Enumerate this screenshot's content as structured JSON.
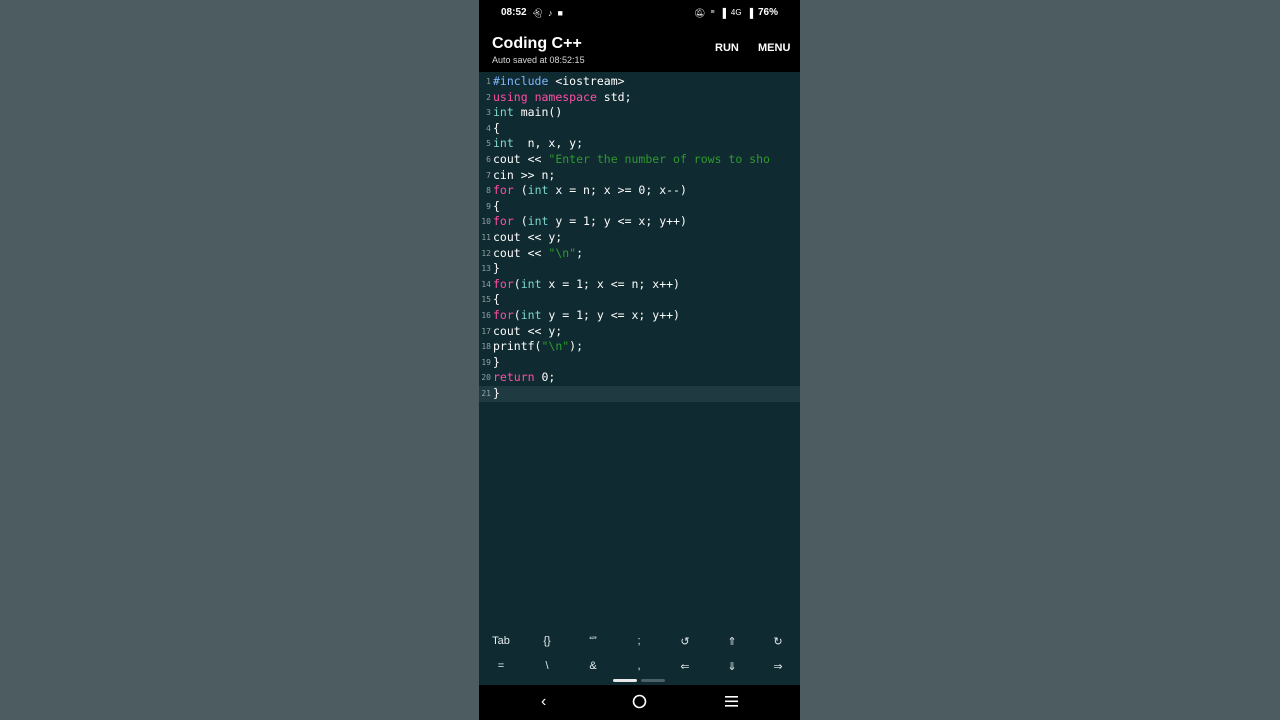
{
  "status": {
    "time": "08:52",
    "left_icons": [
      "snapchat-icon",
      "tiktok-icon",
      "video-icon"
    ],
    "right_icons": [
      "silent-icon",
      "volte-icon",
      "signal-icon",
      "4g-icon",
      "signal-icon"
    ],
    "network": "4G",
    "battery": "76%"
  },
  "app": {
    "title": "Coding C++",
    "autosave": "Auto saved at 08:52:15",
    "run_label": "RUN",
    "menu_label": "MENU"
  },
  "editor": {
    "lines": [
      {
        "n": "1",
        "segments": [
          {
            "t": "#include",
            "c": "kw-blue"
          },
          {
            "t": " <iostream>",
            "c": ""
          }
        ]
      },
      {
        "n": "2",
        "segments": [
          {
            "t": "using",
            "c": "kw-pink"
          },
          {
            "t": " ",
            "c": ""
          },
          {
            "t": "namespace",
            "c": "kw-pink"
          },
          {
            "t": " std;",
            "c": ""
          }
        ]
      },
      {
        "n": "3",
        "segments": [
          {
            "t": "int",
            "c": "kw-teal"
          },
          {
            "t": " main()",
            "c": ""
          }
        ]
      },
      {
        "n": "4",
        "segments": [
          {
            "t": "{",
            "c": ""
          }
        ]
      },
      {
        "n": "5",
        "segments": [
          {
            "t": "int",
            "c": "kw-teal"
          },
          {
            "t": "  n, x, y;",
            "c": ""
          }
        ]
      },
      {
        "n": "6",
        "segments": [
          {
            "t": "cout << ",
            "c": ""
          },
          {
            "t": "\"Enter the number of rows to sho",
            "c": "str"
          }
        ]
      },
      {
        "n": "7",
        "segments": [
          {
            "t": "cin >> n;",
            "c": ""
          }
        ]
      },
      {
        "n": "8",
        "segments": [
          {
            "t": "for",
            "c": "kw-pink"
          },
          {
            "t": " (",
            "c": ""
          },
          {
            "t": "int",
            "c": "kw-teal"
          },
          {
            "t": " x = n; x >= 0; x--)",
            "c": ""
          }
        ]
      },
      {
        "n": "9",
        "segments": [
          {
            "t": "{",
            "c": ""
          }
        ]
      },
      {
        "n": "10",
        "segments": [
          {
            "t": "for",
            "c": "kw-pink"
          },
          {
            "t": " (",
            "c": ""
          },
          {
            "t": "int",
            "c": "kw-teal"
          },
          {
            "t": " y = 1; y <= x; y++)",
            "c": ""
          }
        ]
      },
      {
        "n": "11",
        "segments": [
          {
            "t": "cout << y;",
            "c": ""
          }
        ]
      },
      {
        "n": "12",
        "segments": [
          {
            "t": "cout << ",
            "c": ""
          },
          {
            "t": "\"\\n\"",
            "c": "str"
          },
          {
            "t": ";",
            "c": ""
          }
        ]
      },
      {
        "n": "13",
        "segments": [
          {
            "t": "}",
            "c": ""
          }
        ]
      },
      {
        "n": "14",
        "segments": [
          {
            "t": "for",
            "c": "kw-pink"
          },
          {
            "t": "(",
            "c": ""
          },
          {
            "t": "int",
            "c": "kw-teal"
          },
          {
            "t": " x = 1; x <= n; x++)",
            "c": ""
          }
        ]
      },
      {
        "n": "15",
        "segments": [
          {
            "t": "{",
            "c": ""
          }
        ]
      },
      {
        "n": "16",
        "segments": [
          {
            "t": "for",
            "c": "kw-pink"
          },
          {
            "t": "(",
            "c": ""
          },
          {
            "t": "int",
            "c": "kw-teal"
          },
          {
            "t": " y = 1; y <= x; y++)",
            "c": ""
          }
        ]
      },
      {
        "n": "17",
        "segments": [
          {
            "t": "cout << y;",
            "c": ""
          }
        ]
      },
      {
        "n": "18",
        "segments": [
          {
            "t": "printf(",
            "c": ""
          },
          {
            "t": "\"\\n\"",
            "c": "str"
          },
          {
            "t": ");",
            "c": ""
          }
        ]
      },
      {
        "n": "19",
        "segments": [
          {
            "t": "}",
            "c": ""
          }
        ]
      },
      {
        "n": "20",
        "segments": [
          {
            "t": "return",
            "c": "kw-pink"
          },
          {
            "t": " 0;",
            "c": ""
          }
        ]
      },
      {
        "n": "21",
        "segments": [
          {
            "t": "}",
            "c": ""
          }
        ],
        "current": true
      }
    ]
  },
  "keys": {
    "row1": [
      "Tab",
      "{}",
      "“”",
      ";",
      "↺",
      "⇑",
      "↻"
    ],
    "row2": [
      "=",
      "\\",
      "&",
      ",",
      "⇐",
      "⇓",
      "⇒"
    ]
  },
  "nav": {
    "back_icon": "back-icon",
    "home_icon": "home-icon",
    "recents_icon": "recents-icon"
  },
  "colors": {
    "editor_bg": "#0f2a30",
    "keyword_blue": "#7fb7ff",
    "keyword_pink": "#ff4fa6",
    "keyword_teal": "#7dd7cf",
    "string_green": "#2f9a2f"
  }
}
